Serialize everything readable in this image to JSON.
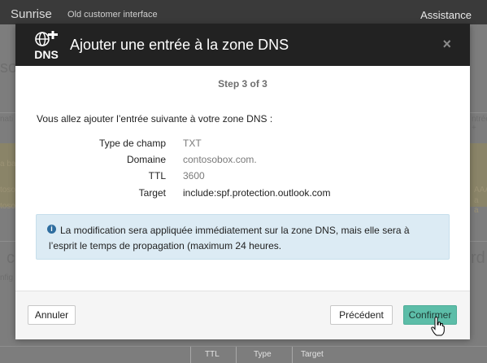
{
  "background": {
    "brand": "Sunrise",
    "subtitle": "Old customer interface",
    "help": "Assistance",
    "fragments": {
      "left_big_1": "so",
      "left_small_1": "nati",
      "left_warn_1": "a ba",
      "left_warn_2": "toso",
      "left_warn_3": "toso",
      "left_big_2": "c",
      "left_small_2": "nfig",
      "right_small_1": "ntrée +",
      "right_warn_1": "AAA",
      "right_warn_2": "a",
      "right_warn_3": "a",
      "right_big_1": "rd"
    },
    "table_headers": [
      "TTL",
      "Type",
      "Target"
    ]
  },
  "dialog": {
    "logo_text": "DNS",
    "title": "Ajouter une entrée à la zone DNS",
    "close_icon": "×",
    "step": "Step 3 of 3",
    "intro": "Vous allez ajouter l’entrée suivante à votre zone DNS :",
    "fields": [
      {
        "label": "Type de champ",
        "value": "TXT"
      },
      {
        "label": "Domaine",
        "value": "contosobox.com."
      },
      {
        "label": "TTL",
        "value": "3600"
      },
      {
        "label": "Target",
        "value": "include:spf.protection.outlook.com"
      }
    ],
    "info_text": "La modification sera appliquée immédiatement sur la zone DNS, mais elle sera à l’esprit le temps de propagation (maximum 24 heures.",
    "buttons": {
      "cancel": "Annuler",
      "previous": "Précédent",
      "confirm": "Confirmer"
    }
  },
  "colors": {
    "header_bg": "#222222",
    "confirm_bg": "#5cbda8",
    "info_bg": "#dcebf4",
    "overlay": "#7f7f7f"
  }
}
